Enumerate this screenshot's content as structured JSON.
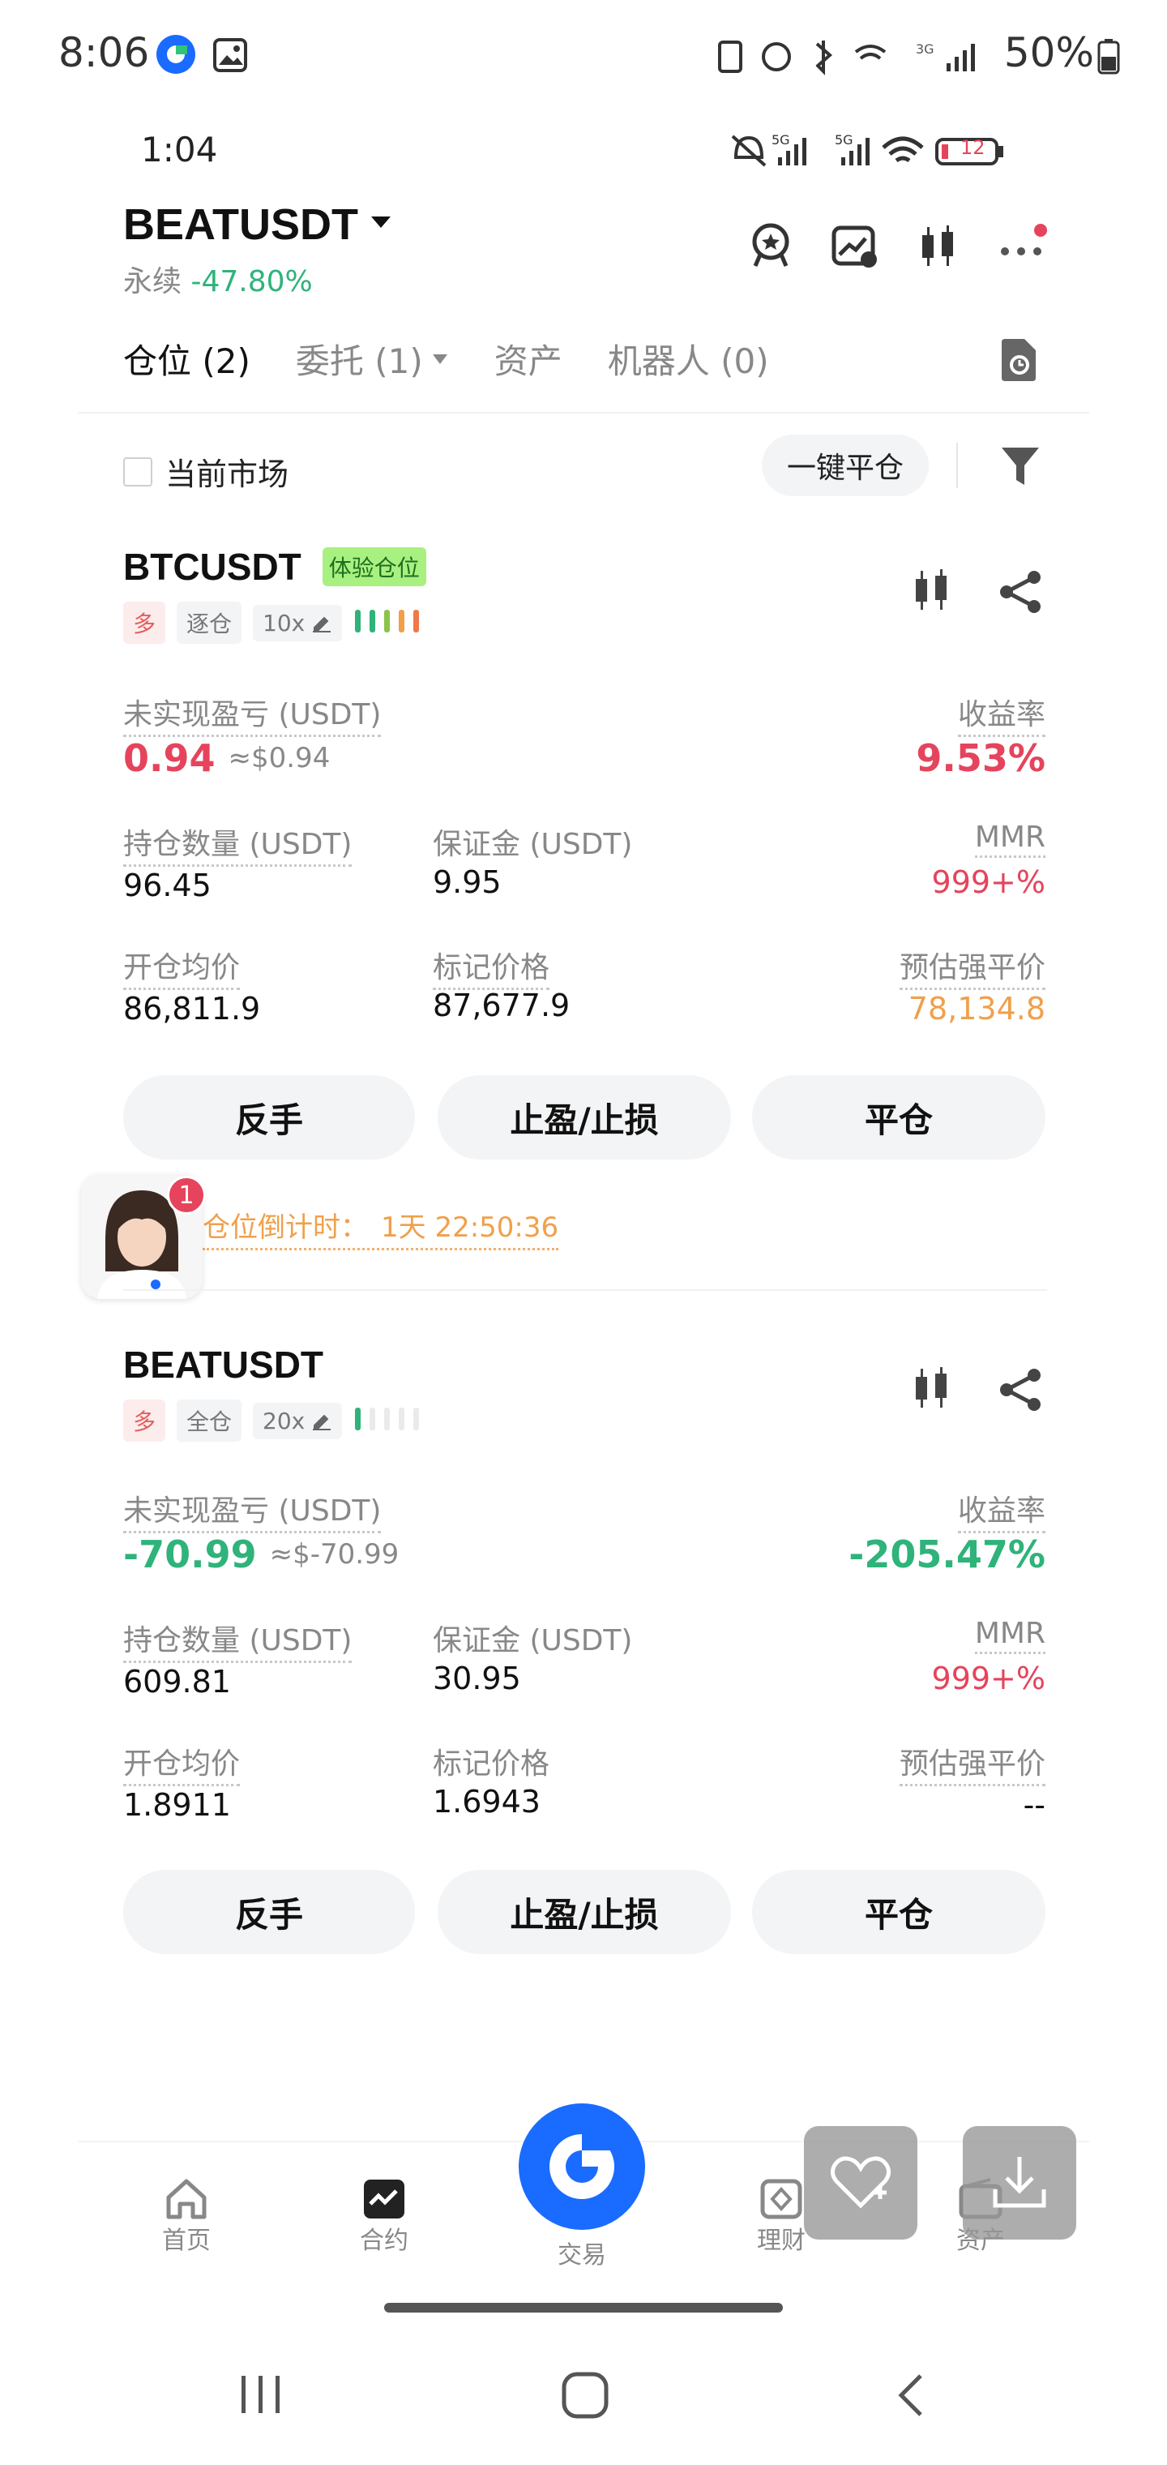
{
  "outer_status": {
    "time": "8:06",
    "battery": "50%"
  },
  "inner_status": {
    "time": "1:04",
    "battery_level": "12"
  },
  "header": {
    "symbol": "BEATUSDT",
    "type_label": "永续",
    "change": "-47.80%"
  },
  "tabs": [
    {
      "label": "仓位 (2)"
    },
    {
      "label": "委托 (1)"
    },
    {
      "label": "资产"
    },
    {
      "label": "机器人 (0)"
    }
  ],
  "filter": {
    "current_market_label": "当前市场",
    "close_all_label": "一键平仓"
  },
  "positions": [
    {
      "symbol": "BTCUSDT",
      "badge": "体验仓位",
      "side": "多",
      "margin_mode": "逐仓",
      "leverage": "10x",
      "pnl_label": "未实现盈亏 (USDT)",
      "pnl": "0.94",
      "pnl_approx": "≈$0.94",
      "roe_label": "收益率",
      "roe": "9.53%",
      "size_label": "持仓数量 (USDT)",
      "size": "96.45",
      "margin_label": "保证金 (USDT)",
      "margin": "9.95",
      "mmr_label": "MMR",
      "mmr": "999+%",
      "entry_label": "开仓均价",
      "entry": "86,811.9",
      "mark_label": "标记价格",
      "mark": "87,677.9",
      "liq_label": "预估强平价",
      "liq": "78,134.8",
      "countdown_label": "仓位倒计时：",
      "countdown": "1天 22:50:36"
    },
    {
      "symbol": "BEATUSDT",
      "side": "多",
      "margin_mode": "全仓",
      "leverage": "20x",
      "pnl_label": "未实现盈亏 (USDT)",
      "pnl": "-70.99",
      "pnl_approx": "≈$-70.99",
      "roe_label": "收益率",
      "roe": "-205.47%",
      "size_label": "持仓数量 (USDT)",
      "size": "609.81",
      "margin_label": "保证金 (USDT)",
      "margin": "30.95",
      "mmr_label": "MMR",
      "mmr": "999+%",
      "entry_label": "开仓均价",
      "entry": "1.8911",
      "mark_label": "标记价格",
      "mark": "1.6943",
      "liq_label": "预估强平价",
      "liq": "--"
    }
  ],
  "buttons": {
    "reverse": "反手",
    "tpsl": "止盈/止损",
    "close": "平仓"
  },
  "assistant_badge": "1",
  "bottom_nav": [
    {
      "label": "首页",
      "icon": "home-icon"
    },
    {
      "label": "合约",
      "icon": "futures-icon"
    },
    {
      "label": "交易",
      "icon": "trade-icon"
    },
    {
      "label": "理财",
      "icon": "earn-icon"
    },
    {
      "label": "资产",
      "icon": "wallet-icon"
    }
  ],
  "colors": {
    "red": "#e5445c",
    "green": "#2fb37b",
    "orange": "#f0a04b",
    "brand_blue": "#1a6bff"
  }
}
